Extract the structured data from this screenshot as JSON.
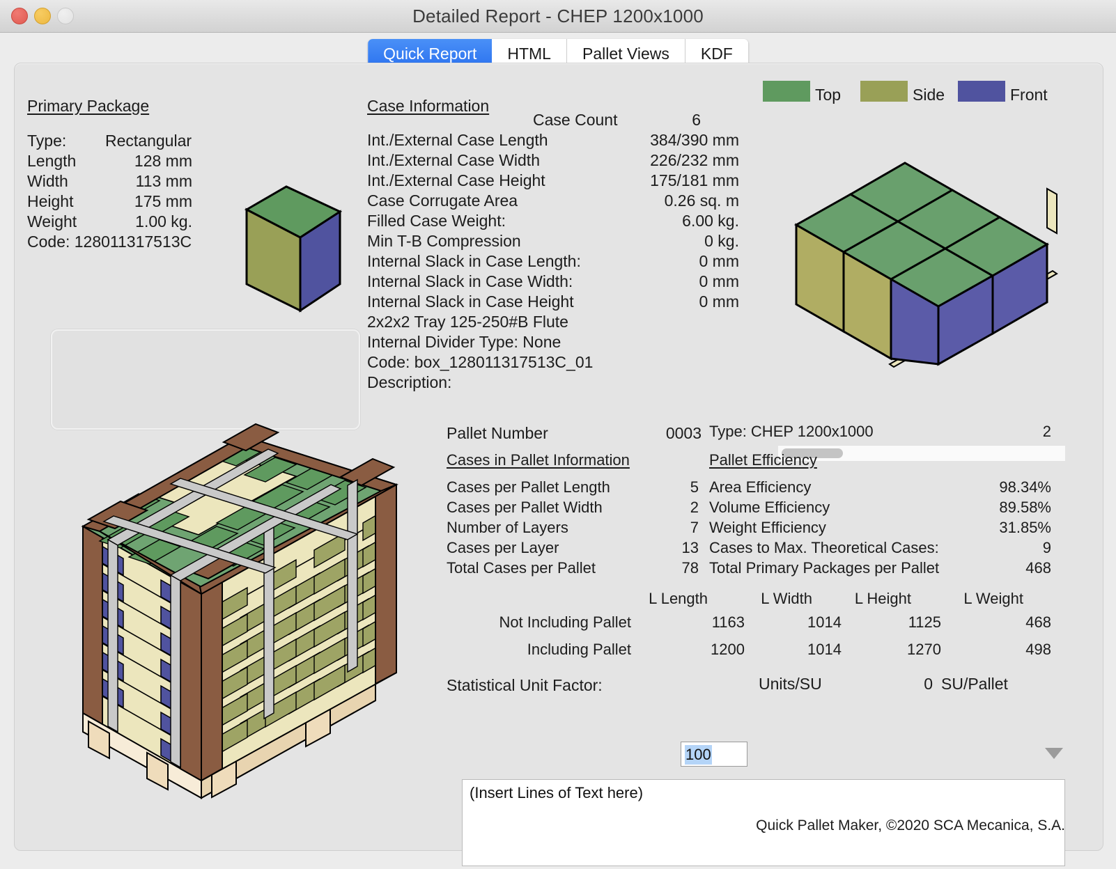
{
  "window": {
    "title": "Detailed Report - CHEP 1200x1000",
    "buttons": {
      "close": "close",
      "minimize": "minimize",
      "zoom": "zoom"
    }
  },
  "tabs": [
    {
      "label": "Quick Report",
      "active": true
    },
    {
      "label": "HTML",
      "active": false
    },
    {
      "label": "Pallet Views",
      "active": false
    },
    {
      "label": "KDF",
      "active": false
    }
  ],
  "primary_package": {
    "heading": "Primary Package",
    "rows": [
      {
        "label": "Type:",
        "value": "Rectangular"
      },
      {
        "label": "Length",
        "value": "128 mm"
      },
      {
        "label": "Width",
        "value": "113 mm"
      },
      {
        "label": "Height",
        "value": "175 mm"
      },
      {
        "label": "Weight",
        "value": "1.00 kg."
      }
    ],
    "code": "Code: 128011317513C"
  },
  "case_information": {
    "heading": "Case Information",
    "case_count_label": "Case Count",
    "case_count_value": "6",
    "rows": [
      {
        "label": "Int./External Case Length",
        "value": "384/390 mm"
      },
      {
        "label": "Int./External Case Width",
        "value": "226/232 mm"
      },
      {
        "label": "Int./External Case Height",
        "value": "175/181 mm"
      },
      {
        "label": "Case Corrugate Area",
        "value": "0.26 sq. m"
      },
      {
        "label": "Filled Case Weight:",
        "value": "6.00 kg."
      },
      {
        "label": "Min T-B Compression",
        "value": "0 kg."
      },
      {
        "label": "Internal Slack in Case Length:",
        "value": "0 mm"
      },
      {
        "label": "Internal Slack in Case Width:",
        "value": "0 mm"
      },
      {
        "label": "Internal Slack in Case Height",
        "value": "0 mm"
      }
    ],
    "tray": "2x2x2 Tray 125-250#B Flute",
    "divider": "Internal Divider Type: None",
    "code": "Code: box_128011317513C_01",
    "description": "Description:"
  },
  "legend": [
    {
      "label": "Top",
      "color": "#5f9a5f"
    },
    {
      "label": "Side",
      "color": "#99a057"
    },
    {
      "label": "Front",
      "color": "#50539f"
    }
  ],
  "pallet": {
    "number_label": "Pallet Number",
    "number_value": "0003",
    "type_text": "Type: CHEP 1200x1000",
    "right_count": "2",
    "cases_heading": "Cases in Pallet Information",
    "efficiency_heading": "Pallet Efficiency",
    "cases_rows": [
      {
        "label": "Cases per Pallet Length",
        "value": "5"
      },
      {
        "label": "Cases per Pallet Width",
        "value": "2"
      },
      {
        "label": "Number of Layers",
        "value": "7"
      },
      {
        "label": "Cases per Layer",
        "value": "13"
      },
      {
        "label": "Total Cases per Pallet",
        "value": "78"
      }
    ],
    "efficiency_rows": [
      {
        "label": "Area Efficiency",
        "value": "98.34%"
      },
      {
        "label": "Volume Efficiency",
        "value": "89.58%"
      },
      {
        "label": "Weight Efficiency",
        "value": "31.85%"
      },
      {
        "label": "Cases to Max. Theoretical Cases:",
        "value": "9"
      },
      {
        "label": "Total Primary Packages per Pallet",
        "value": "468"
      }
    ],
    "table": {
      "columns": [
        "L Length",
        "L Width",
        "L Height",
        "L Weight"
      ],
      "rows": [
        {
          "label": "Not Including Pallet",
          "values": [
            "1163",
            "1014",
            "1125",
            "468"
          ]
        },
        {
          "label": "Including Pallet",
          "values": [
            "1200",
            "1014",
            "1270",
            "498"
          ]
        }
      ]
    },
    "statistical": {
      "label": "Statistical Unit Factor:",
      "input_value": "100",
      "units_label": "Units/SU",
      "su_value": "0",
      "su_label": "SU/Pallet",
      "dropdown_icon": "chevron-down-icon"
    },
    "notes_placeholder": "(Insert Lines of Text here)"
  },
  "footer": "Quick Pallet Maker, ©2020 SCA Mecanica, S.A."
}
